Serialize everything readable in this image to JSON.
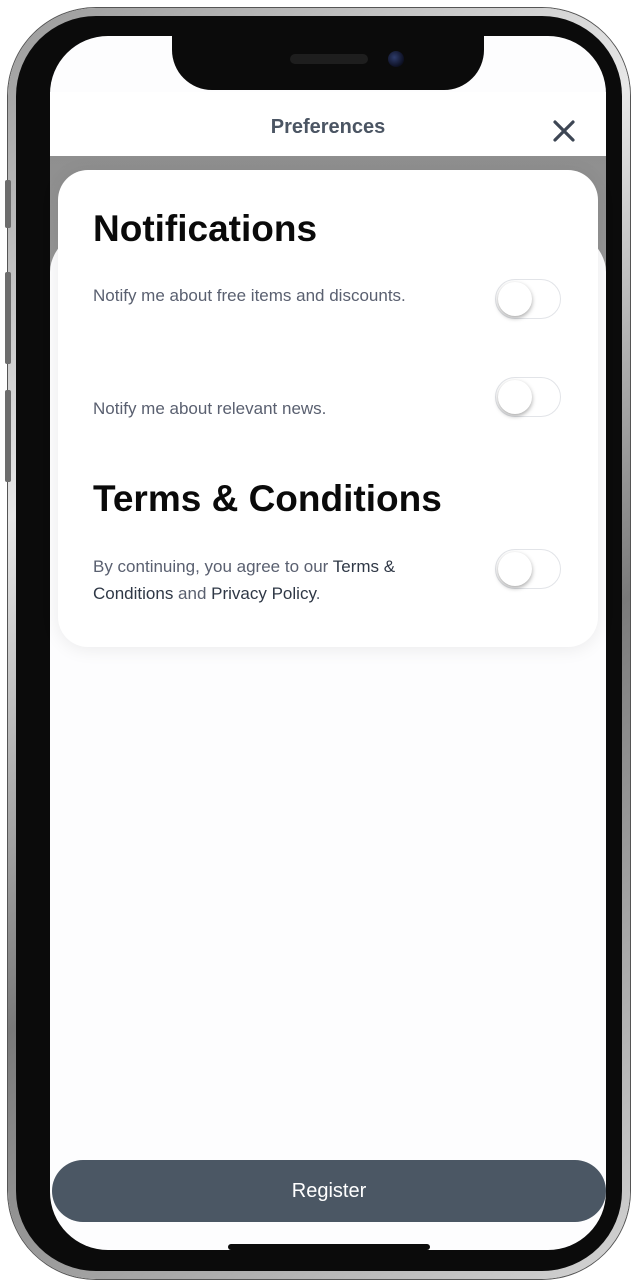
{
  "header": {
    "title": "Preferences",
    "close_icon": "close-icon"
  },
  "notifications": {
    "heading": "Notifications",
    "items": [
      {
        "label": "Notify me about free items and discounts.",
        "enabled": false
      },
      {
        "label": "Notify me about relevant news.",
        "enabled": false
      }
    ]
  },
  "terms": {
    "heading": "Terms & Conditions",
    "text_prefix": "By continuing, you agree to our ",
    "terms_link": "Terms & Conditions",
    "text_middle": " and ",
    "privacy_link": "Privacy Policy",
    "text_suffix": ".",
    "enabled": false
  },
  "footer": {
    "register_label": "Register"
  },
  "colors": {
    "button_bg": "#4b5764",
    "title_text": "#4b5563",
    "body_text": "#5a6070"
  }
}
